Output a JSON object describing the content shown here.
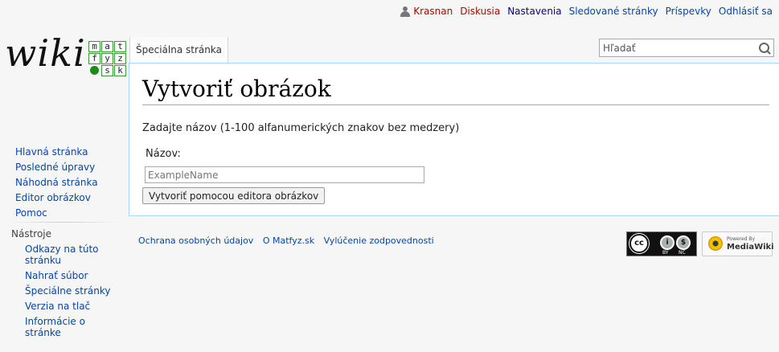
{
  "personal": {
    "username": "Krasnan",
    "talk": "Diskusia",
    "preferences": "Nastavenia",
    "watchlist": "Sledované stránky",
    "contributions": "Príspevky",
    "logout": "Odhlásiť sa"
  },
  "logo": {
    "wordmark": "wiki",
    "tiles": [
      "m",
      "a",
      "t",
      "f",
      "y",
      "z",
      "",
      "s",
      "k"
    ]
  },
  "tabs": {
    "special_page": "Špeciálna stránka"
  },
  "search": {
    "placeholder": "Hľadať"
  },
  "page": {
    "title": "Vytvoriť obrázok",
    "intro": "Zadajte názov (1-100 alfanumerických znakov bez medzery)",
    "name_label": "Názov:",
    "name_placeholder": "ExampleName",
    "create_button": "Vytvoriť pomocou editora obrázkov"
  },
  "nav": {
    "items": [
      "Hlavná stránka",
      "Posledné úpravy",
      "Náhodná stránka",
      "Editor obrázkov",
      "Pomoc"
    ]
  },
  "tools": {
    "heading": "Nástroje",
    "items": [
      "Odkazy na túto stránku",
      "Nahrať súbor",
      "Špeciálne stránky",
      "Verzia na tlač",
      "Informácie o stránke"
    ]
  },
  "footer": {
    "links": [
      "Ochrana osobných údajov",
      "O Matfyz.sk",
      "Vylúčenie zodpovednosti"
    ],
    "cc_labels": [
      "BY",
      "NC"
    ],
    "mediawiki_line1": "Powered By",
    "mediawiki_line2": "MediaWiki"
  }
}
